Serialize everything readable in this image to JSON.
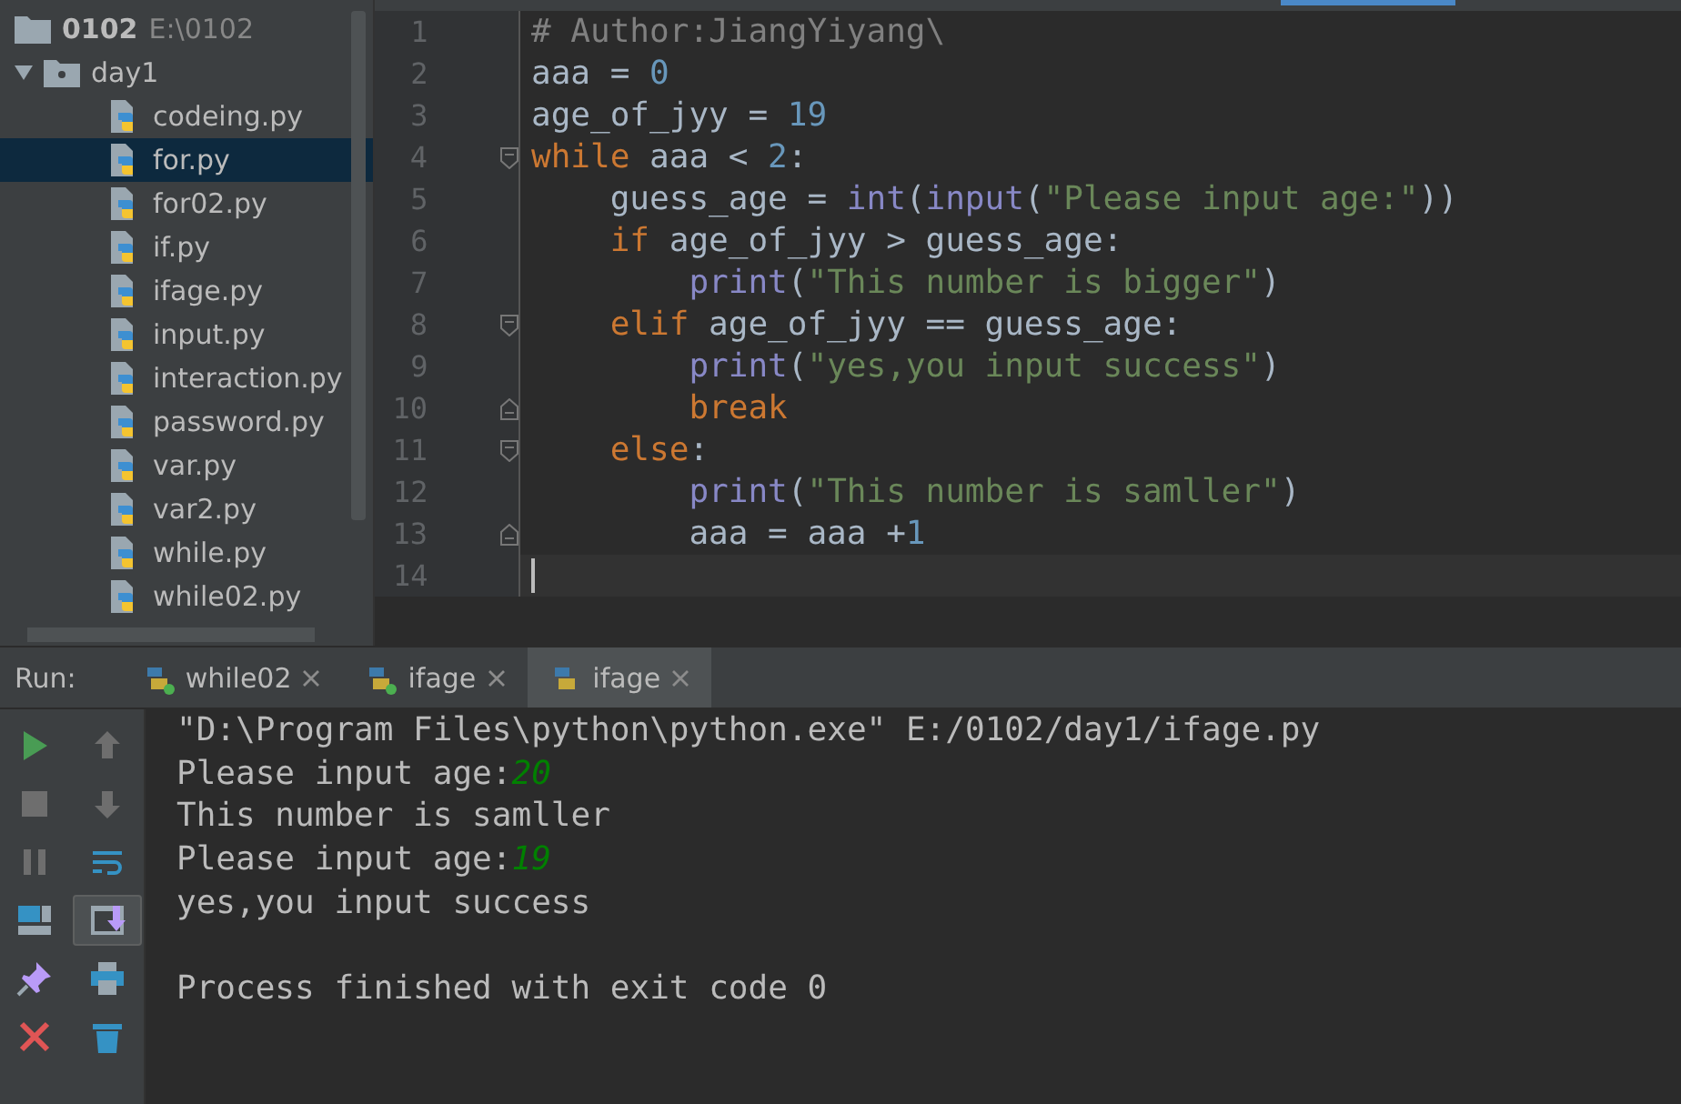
{
  "project_tree": {
    "name": "0102",
    "path": "E:\\0102",
    "children": [
      {
        "name": "day1",
        "kind": "folder",
        "expanded": true,
        "selected": false,
        "children": [
          {
            "name": "codeing.py",
            "kind": "python",
            "selected": false
          },
          {
            "name": "for.py",
            "kind": "python",
            "selected": true
          },
          {
            "name": "for02.py",
            "kind": "python",
            "selected": false
          },
          {
            "name": "if.py",
            "kind": "python",
            "selected": false
          },
          {
            "name": "ifage.py",
            "kind": "python",
            "selected": false
          },
          {
            "name": "input.py",
            "kind": "python",
            "selected": false
          },
          {
            "name": "interaction.py",
            "kind": "python",
            "selected": false
          },
          {
            "name": "password.py",
            "kind": "python",
            "selected": false
          },
          {
            "name": "var.py",
            "kind": "python",
            "selected": false
          },
          {
            "name": "var2.py",
            "kind": "python",
            "selected": false
          },
          {
            "name": "while.py",
            "kind": "python",
            "selected": false
          },
          {
            "name": "while02.py",
            "kind": "python",
            "selected": false
          }
        ]
      }
    ]
  },
  "editor": {
    "lines": [
      {
        "number": "1",
        "fold_open": false,
        "fold_close": false,
        "current": false,
        "tokens": [
          {
            "kind": "comment",
            "text": "# Author:JiangYiyang\\"
          }
        ]
      },
      {
        "number": "2",
        "fold_open": false,
        "fold_close": false,
        "current": false,
        "tokens": [
          {
            "kind": "plain",
            "text": "aaa = "
          },
          {
            "kind": "number",
            "text": "0"
          }
        ]
      },
      {
        "number": "3",
        "fold_open": false,
        "fold_close": false,
        "current": false,
        "tokens": [
          {
            "kind": "plain",
            "text": "age_of_jyy = "
          },
          {
            "kind": "number",
            "text": "19"
          }
        ]
      },
      {
        "number": "4",
        "fold_open": true,
        "fold_close": false,
        "current": false,
        "tokens": [
          {
            "kind": "keyword",
            "text": "while"
          },
          {
            "kind": "plain",
            "text": " aaa < "
          },
          {
            "kind": "number",
            "text": "2"
          },
          {
            "kind": "plain",
            "text": ":"
          }
        ]
      },
      {
        "number": "5",
        "fold_open": false,
        "fold_close": false,
        "current": false,
        "tokens": [
          {
            "kind": "plain",
            "text": "    guess_age = "
          },
          {
            "kind": "builtin",
            "text": "int"
          },
          {
            "kind": "plain",
            "text": "("
          },
          {
            "kind": "builtin",
            "text": "input"
          },
          {
            "kind": "plain",
            "text": "("
          },
          {
            "kind": "string",
            "text": "\"Please input age:\""
          },
          {
            "kind": "plain",
            "text": "))"
          }
        ]
      },
      {
        "number": "6",
        "fold_open": false,
        "fold_close": false,
        "current": false,
        "tokens": [
          {
            "kind": "keyword",
            "text": "    if"
          },
          {
            "kind": "plain",
            "text": " age_of_jyy > guess_age:"
          }
        ]
      },
      {
        "number": "7",
        "fold_open": false,
        "fold_close": false,
        "current": false,
        "tokens": [
          {
            "kind": "builtin",
            "text": "        print"
          },
          {
            "kind": "plain",
            "text": "("
          },
          {
            "kind": "string",
            "text": "\"This number is bigger\""
          },
          {
            "kind": "plain",
            "text": ")"
          }
        ]
      },
      {
        "number": "8",
        "fold_open": true,
        "fold_close": false,
        "current": false,
        "tokens": [
          {
            "kind": "keyword",
            "text": "    elif"
          },
          {
            "kind": "plain",
            "text": " age_of_jyy == guess_age:"
          }
        ]
      },
      {
        "number": "9",
        "fold_open": false,
        "fold_close": false,
        "current": false,
        "tokens": [
          {
            "kind": "builtin",
            "text": "        print"
          },
          {
            "kind": "plain",
            "text": "("
          },
          {
            "kind": "string",
            "text": "\"yes,you input success\""
          },
          {
            "kind": "plain",
            "text": ")"
          }
        ]
      },
      {
        "number": "10",
        "fold_open": false,
        "fold_close": true,
        "current": false,
        "tokens": [
          {
            "kind": "keyword",
            "text": "        break"
          }
        ]
      },
      {
        "number": "11",
        "fold_open": true,
        "fold_close": false,
        "current": false,
        "tokens": [
          {
            "kind": "keyword",
            "text": "    else"
          },
          {
            "kind": "plain",
            "text": ":"
          }
        ]
      },
      {
        "number": "12",
        "fold_open": false,
        "fold_close": false,
        "current": false,
        "tokens": [
          {
            "kind": "builtin",
            "text": "        print"
          },
          {
            "kind": "plain",
            "text": "("
          },
          {
            "kind": "string",
            "text": "\"This number is samller\""
          },
          {
            "kind": "plain",
            "text": ")"
          }
        ]
      },
      {
        "number": "13",
        "fold_open": false,
        "fold_close": true,
        "current": false,
        "tokens": [
          {
            "kind": "plain",
            "text": "        aaa = aaa +"
          },
          {
            "kind": "number",
            "text": "1"
          }
        ]
      },
      {
        "number": "14",
        "fold_open": false,
        "fold_close": false,
        "current": true
      }
    ]
  },
  "run": {
    "label": "Run:",
    "tabs": [
      {
        "label": "while02",
        "running": true,
        "selected": false
      },
      {
        "label": "ifage",
        "running": true,
        "selected": false
      },
      {
        "label": "ifage",
        "running": false,
        "selected": true
      }
    ],
    "tools": [
      {
        "kind": "run",
        "disabled": false,
        "on": false
      },
      {
        "kind": "up",
        "disabled": true,
        "on": false
      },
      {
        "kind": "stop",
        "disabled": true,
        "on": false
      },
      {
        "kind": "down",
        "disabled": true,
        "on": false
      },
      {
        "kind": "pause",
        "disabled": true,
        "on": false
      },
      {
        "kind": "wrap",
        "disabled": false,
        "on": false
      },
      {
        "kind": "layout",
        "disabled": false,
        "on": false
      },
      {
        "kind": "scroll-end",
        "disabled": false,
        "on": true
      },
      {
        "kind": "pin",
        "disabled": false,
        "on": false
      },
      {
        "kind": "print",
        "disabled": false,
        "on": false
      },
      {
        "kind": "close",
        "disabled": false,
        "on": false
      },
      {
        "kind": "trash",
        "disabled": false,
        "on": false
      }
    ],
    "console": [
      {
        "kind": "text",
        "segments": [
          {
            "kind": "output",
            "text": "\"D:\\Program Files\\python\\python.exe\" E:/0102/day1/ifage.py"
          }
        ]
      },
      {
        "kind": "text",
        "segments": [
          {
            "kind": "output",
            "text": "Please input age:"
          },
          {
            "kind": "input",
            "text": "20"
          }
        ]
      },
      {
        "kind": "text",
        "segments": [
          {
            "kind": "output",
            "text": "This number is samller"
          }
        ]
      },
      {
        "kind": "text",
        "segments": [
          {
            "kind": "output",
            "text": "Please input age:"
          },
          {
            "kind": "input",
            "text": "19"
          }
        ]
      },
      {
        "kind": "text",
        "segments": [
          {
            "kind": "output",
            "text": "yes,you input success"
          }
        ]
      },
      {
        "kind": "blank"
      },
      {
        "kind": "text",
        "segments": [
          {
            "kind": "output",
            "text": "Process finished with exit code 0"
          }
        ]
      }
    ]
  }
}
